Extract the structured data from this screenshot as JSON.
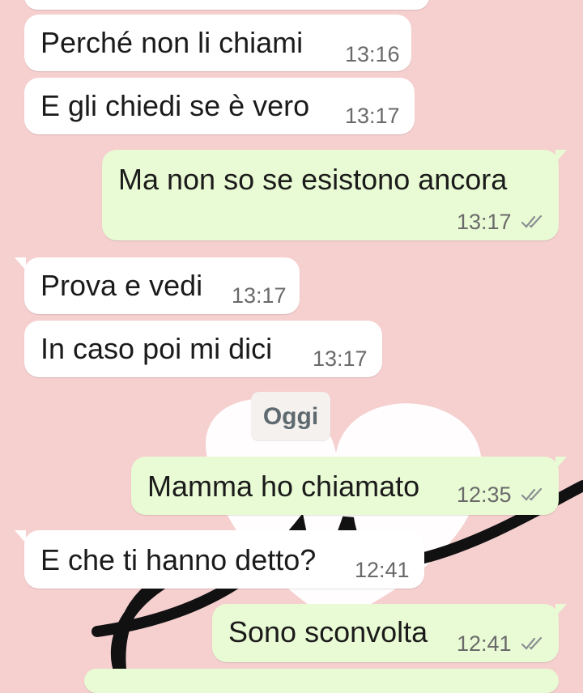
{
  "colors": {
    "background": "#f6cfcf",
    "incoming": "#ffffff",
    "outgoing": "#e9fbd4",
    "ticks": "#8a8f93"
  },
  "date_divider": "Oggi",
  "messages": [
    {
      "text": "Perché non li chiami",
      "time": "13:16",
      "direction": "incoming"
    },
    {
      "text": "E gli chiedi se è vero",
      "time": "13:17",
      "direction": "incoming"
    },
    {
      "text": "Ma non so se esistono ancora",
      "time": "13:17",
      "direction": "outgoing",
      "status": "read"
    },
    {
      "text": "Prova e vedi",
      "time": "13:17",
      "direction": "incoming"
    },
    {
      "text": "In caso poi mi dici",
      "time": "13:17",
      "direction": "incoming"
    },
    {
      "text": "Mamma ho chiamato",
      "time": "12:35",
      "direction": "outgoing",
      "status": "read"
    },
    {
      "text": "E che ti hanno detto?",
      "time": "12:41",
      "direction": "incoming"
    },
    {
      "text": "Sono sconvolta",
      "time": "12:41",
      "direction": "outgoing",
      "status": "read"
    }
  ]
}
